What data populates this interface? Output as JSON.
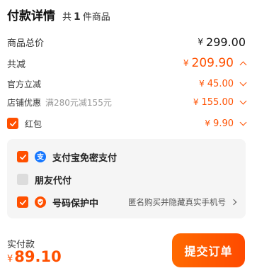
{
  "header": {
    "title": "付款详情",
    "count_prefix": "共",
    "count": "1",
    "count_suffix": "件商品"
  },
  "summary": {
    "total_label": "商品总价",
    "total_currency": "¥",
    "total_value": "299.00",
    "discount_label": "共减",
    "discount_currency": "¥",
    "discount_value": "209.90",
    "official_label": "官方立减",
    "official_currency": "¥",
    "official_value": "45.00",
    "store_label": "店铺优惠",
    "store_sub": "满280元减155元",
    "store_currency": "¥",
    "store_value": "155.00",
    "redpack_label": "红包",
    "redpack_currency": "¥",
    "redpack_value": "9.90"
  },
  "options": {
    "alipay_label": "支付宝免密支付",
    "friend_label": "朋友代付",
    "privacy_label": "号码保护中",
    "privacy_tip": "匿名购买并隐藏真实手机号"
  },
  "footer": {
    "pay_label": "实付款",
    "pay_currency": "¥",
    "pay_value": "89.10",
    "submit_label": "提交订单"
  },
  "colors": {
    "accent": "#ff5000",
    "alipay": "#1677ff",
    "disabled": "#dcdcdc"
  },
  "icons": [
    "checkbox-checked-icon",
    "checkbox-unchecked-icon",
    "chevron-up-icon",
    "chevron-down-icon",
    "chevron-right-icon",
    "alipay-icon",
    "shield-icon"
  ]
}
